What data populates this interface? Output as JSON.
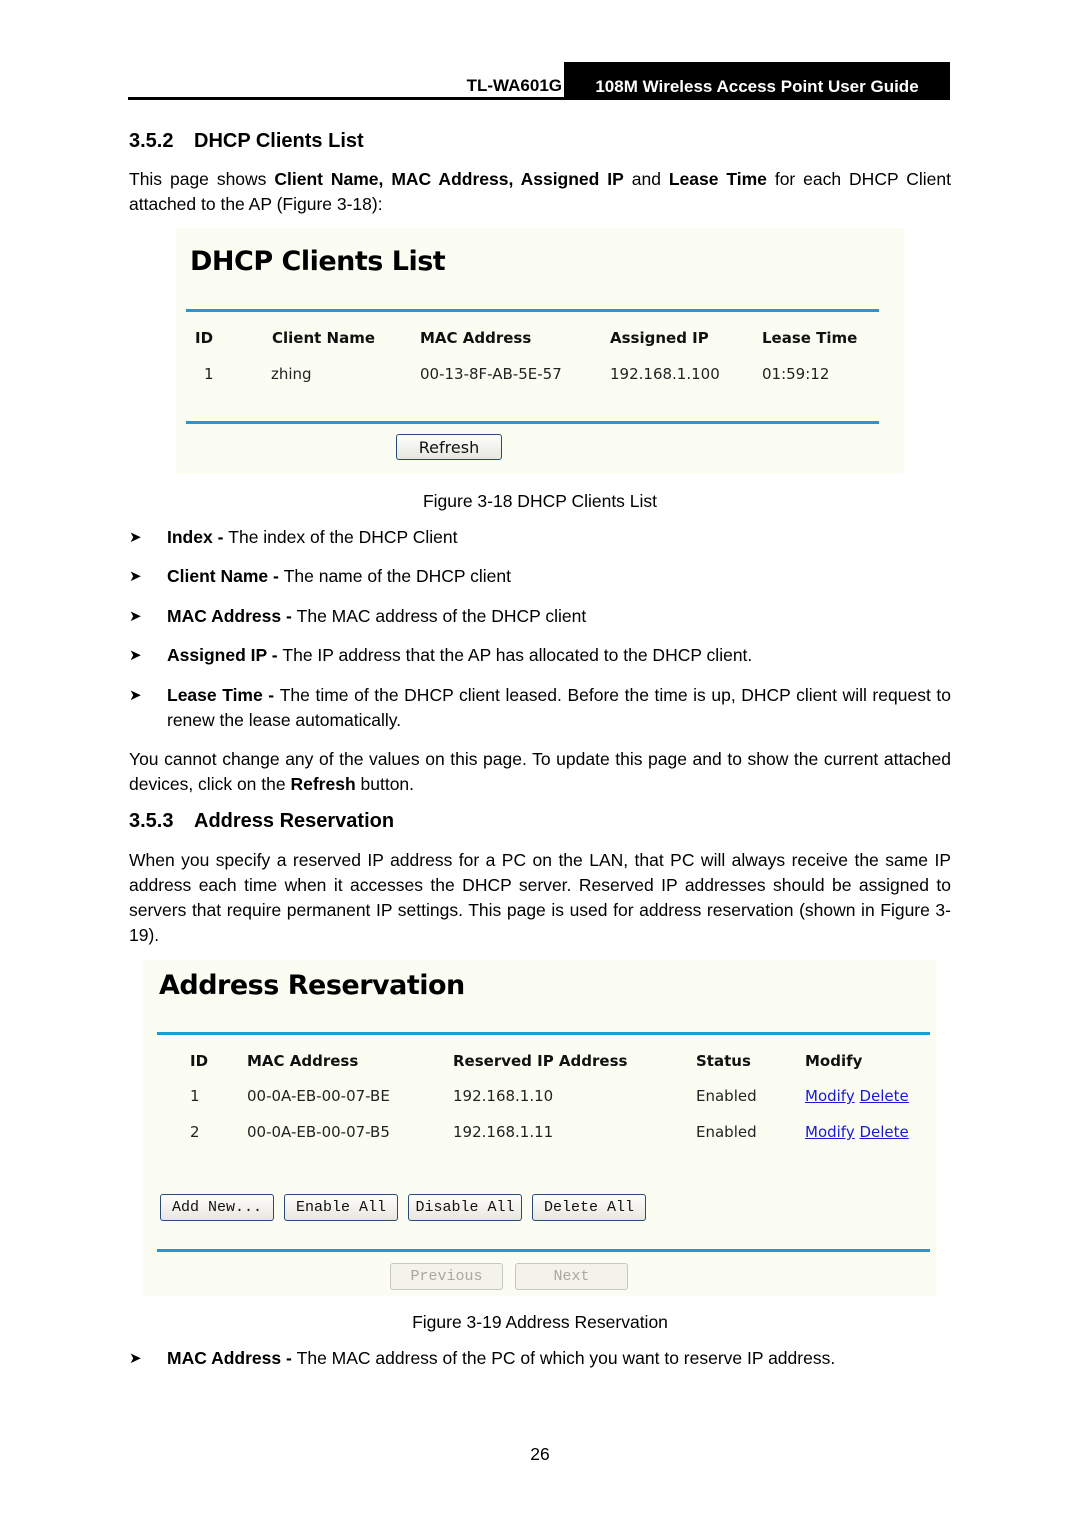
{
  "header": {
    "model": "TL-WA601G",
    "guide_title": "108M Wireless Access Point User Guide"
  },
  "section_352": {
    "number": "3.5.2",
    "title": "DHCP Clients List",
    "intro_parts": [
      {
        "text": "This page shows ",
        "bold": false
      },
      {
        "text": "Client Name, MAC Address, Assigned IP",
        "bold": true
      },
      {
        "text": " and ",
        "bold": false
      },
      {
        "text": "Lease Time",
        "bold": true
      },
      {
        "text": " for each DHCP Client attached to the AP (Figure 3-18):",
        "bold": false
      }
    ]
  },
  "dhcp_panel": {
    "title": "DHCP Clients List",
    "columns": [
      "ID",
      "Client Name",
      "MAC Address",
      "Assigned IP",
      "Lease Time"
    ],
    "rows": [
      [
        "1",
        "zhing",
        "00-13-8F-AB-5E-57",
        "192.168.1.100",
        "01:59:12"
      ]
    ],
    "refresh_label": "Refresh",
    "accent_color": "#1f9bd3",
    "background_color": "#fcfdf2"
  },
  "figure_318_caption": "Figure 3-18 DHCP Clients List",
  "bullets_318": [
    {
      "term": "Index - ",
      "desc": "The index of the DHCP Client"
    },
    {
      "term": "Client Name - ",
      "desc": "The name of the DHCP client"
    },
    {
      "term": "MAC Address - ",
      "desc": "The MAC address of the DHCP client"
    },
    {
      "term": "Assigned IP - ",
      "desc": "The IP address that the AP has allocated to the DHCP client."
    },
    {
      "term": "Lease Time - ",
      "desc": "The time of the DHCP client leased. Before the time is up, DHCP client will request to renew the lease automatically."
    }
  ],
  "note_318": {
    "before": "You cannot change any of the values on this page. To update this page and to show the current attached devices, click on the ",
    "bold": "Refresh",
    "after": " button."
  },
  "section_353": {
    "number": "3.5.3",
    "title": "Address Reservation",
    "intro": "When you specify a reserved IP address for a PC on the LAN, that PC will always receive the same IP address each time when it accesses the DHCP server. Reserved IP addresses should be assigned to servers that require permanent IP settings. This page is used for address reservation (shown in Figure 3-19)."
  },
  "reservation_panel": {
    "title": "Address Reservation",
    "columns": [
      "ID",
      "MAC Address",
      "Reserved IP Address",
      "Status",
      "Modify"
    ],
    "rows": [
      {
        "id": "1",
        "mac": "00-0A-EB-00-07-BE",
        "ip": "192.168.1.10",
        "status": "Enabled",
        "modify": "Modify",
        "delete": "Delete"
      },
      {
        "id": "2",
        "mac": "00-0A-EB-00-07-B5",
        "ip": "192.168.1.11",
        "status": "Enabled",
        "modify": "Modify",
        "delete": "Delete"
      }
    ],
    "buttons": {
      "add_new": "Add New...",
      "enable_all": "Enable All",
      "disable_all": "Disable All",
      "delete_all": "Delete All",
      "previous": "Previous",
      "next": "Next"
    },
    "link_color": "#1a1ad6"
  },
  "figure_319_caption": "Figure 3-19 Address Reservation",
  "bullets_319": [
    {
      "term": "MAC Address - ",
      "desc": "The MAC address of the PC of which you want to reserve IP address."
    }
  ],
  "page_number": "26"
}
